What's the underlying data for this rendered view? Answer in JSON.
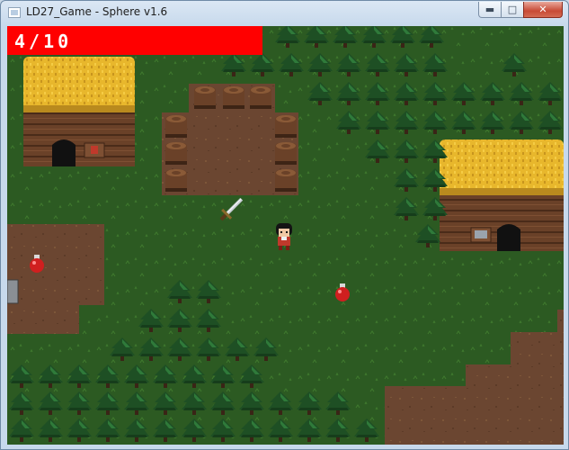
{
  "window": {
    "title": "LD27_Game - Sphere v1.6",
    "controls": {
      "minimize_icon": "minimize-icon",
      "maximize_icon": "maximize-icon",
      "close_icon": "close-icon"
    }
  },
  "hud": {
    "counter_text": "4/10",
    "bar_color": "#ff0000"
  },
  "colors": {
    "grass": "#2c5a22",
    "grass_alt": "#33672a",
    "dirt": "#6b4631",
    "thatch": "#e8b72c",
    "wall": "#6a4128",
    "tree_dark": "#16401d",
    "tree_light": "#2f7a3a"
  },
  "scene": {
    "player": "red-tunic-hero",
    "items": [
      "sword-icon",
      "health-potion-icon",
      "health-potion-icon"
    ],
    "buildings": [
      "thatched-hut-left",
      "thatched-hut-right"
    ]
  }
}
